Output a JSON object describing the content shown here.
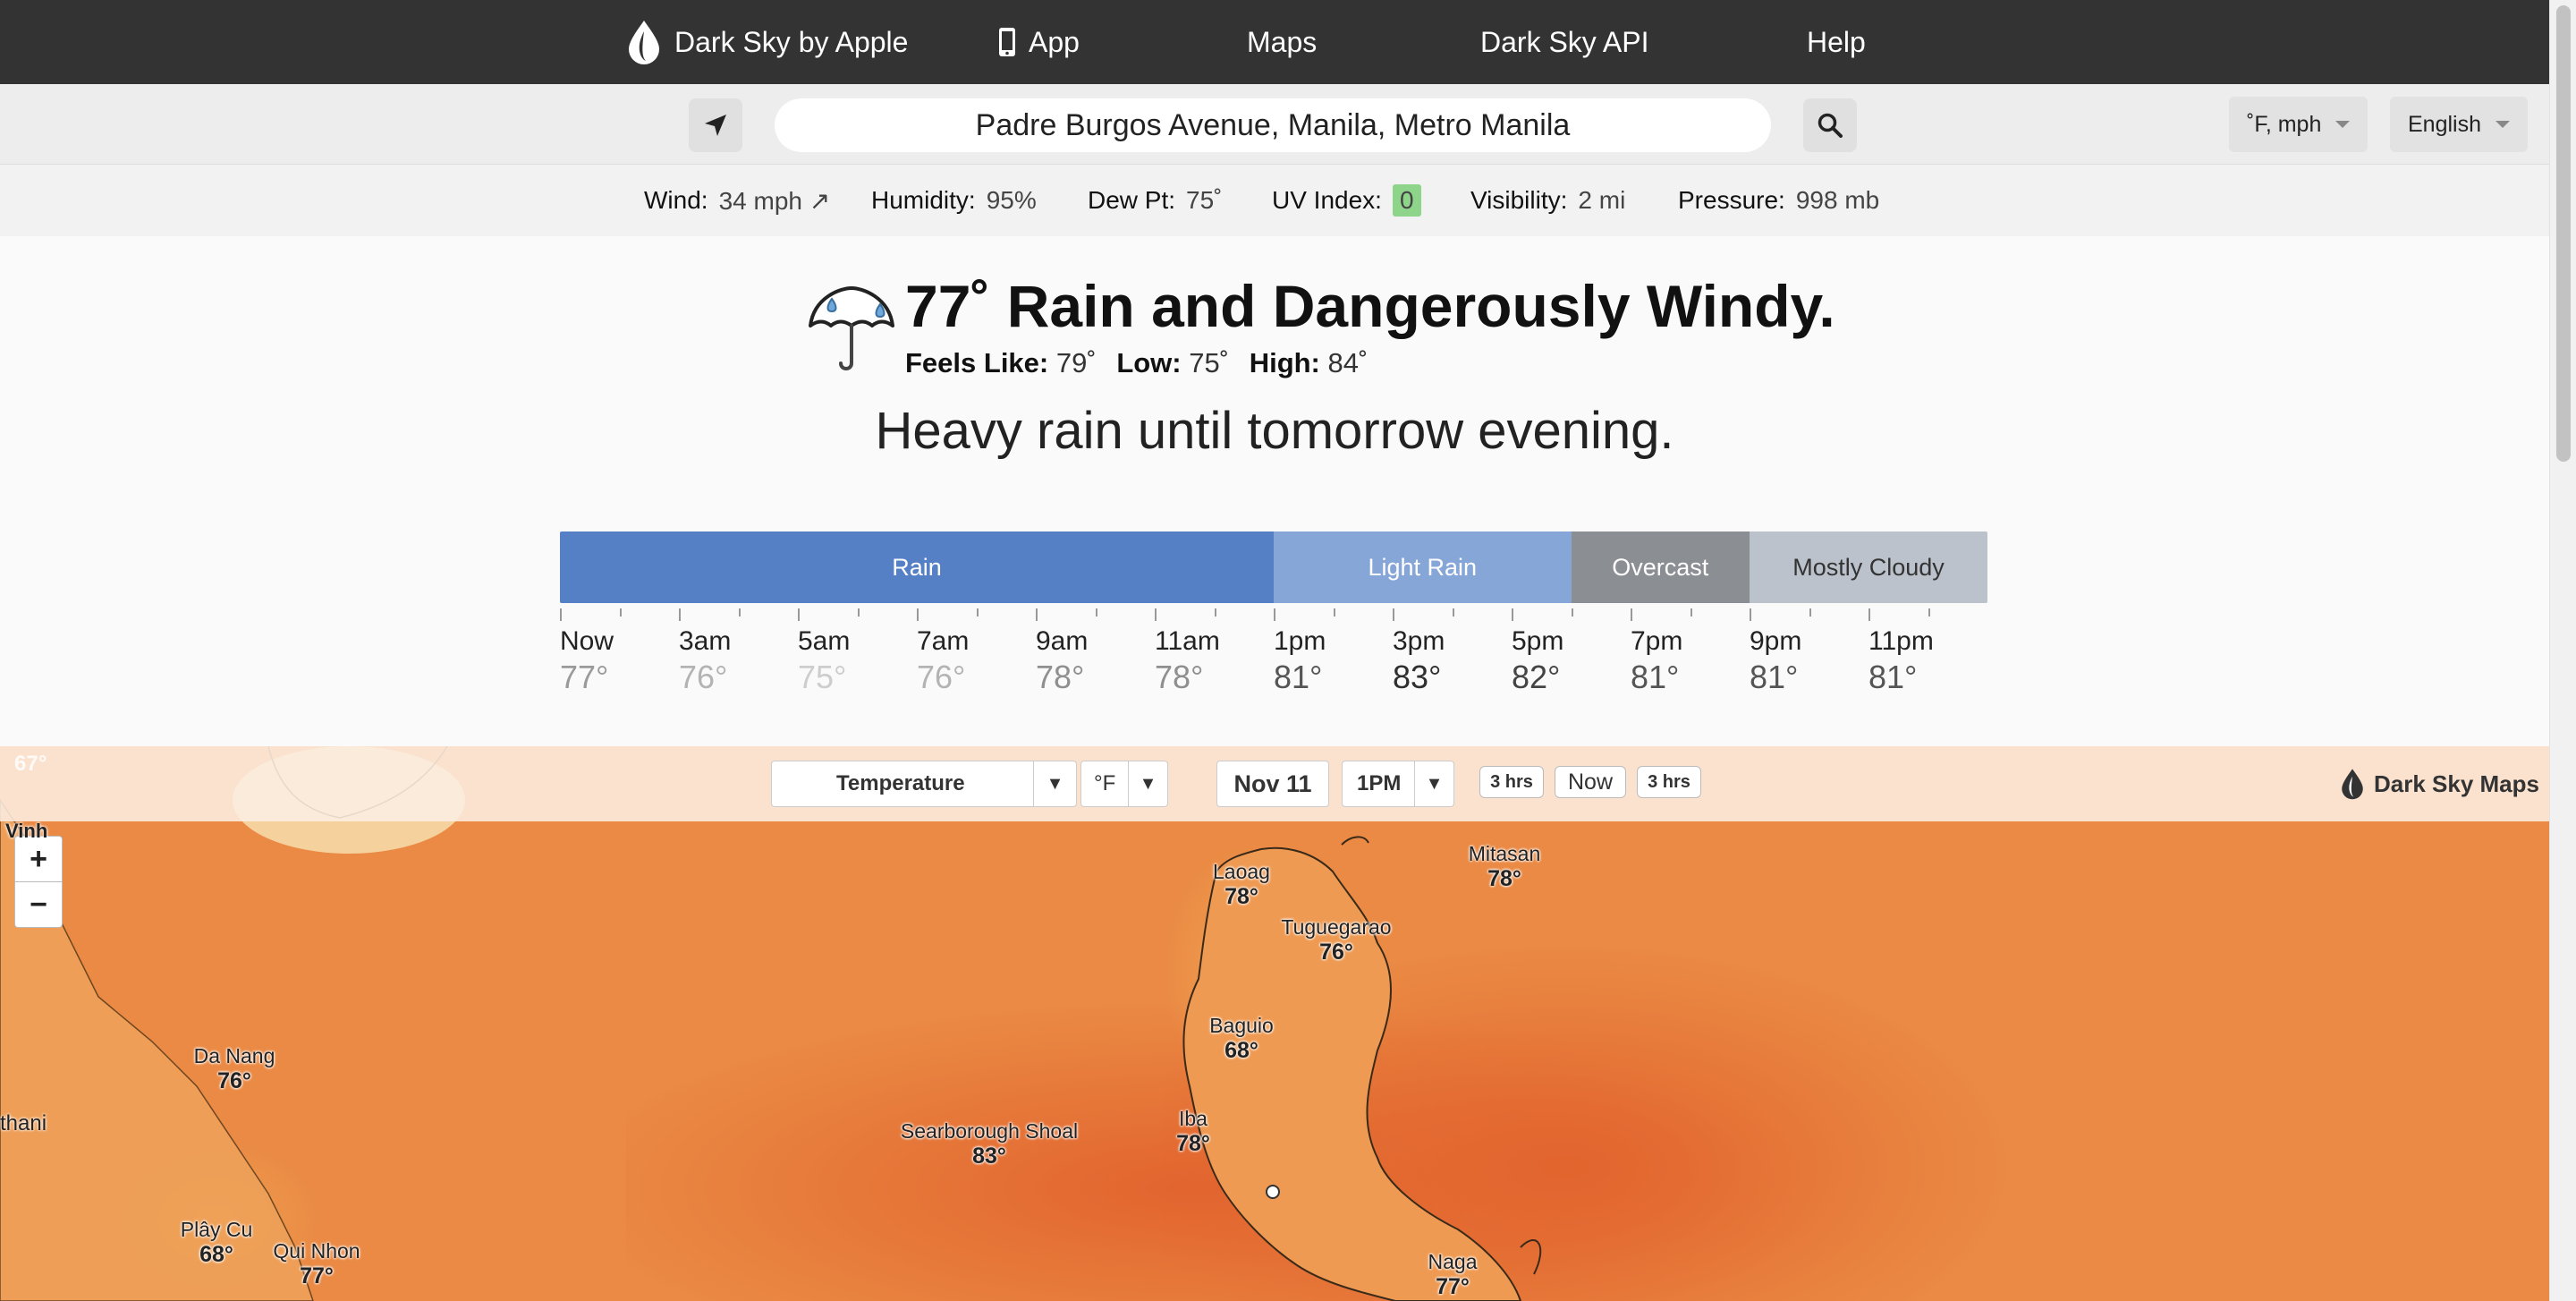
{
  "nav": {
    "brand": "Dark Sky by Apple",
    "app": "App",
    "maps": "Maps",
    "api": "Dark Sky API",
    "help": "Help"
  },
  "search": {
    "location": "Padre Burgos Avenue, Manila, Metro Manila",
    "units": "˚F, mph",
    "language": "English"
  },
  "conditions": {
    "wind_label": "Wind:",
    "wind_value": "34 mph ↗",
    "humidity_label": "Humidity:",
    "humidity_value": "95%",
    "dew_label": "Dew Pt:",
    "dew_value": "75˚",
    "uv_label": "UV Index:",
    "uv_value": "0",
    "visibility_label": "Visibility:",
    "visibility_value": "2 mi",
    "pressure_label": "Pressure:",
    "pressure_value": "998 mb"
  },
  "summary": {
    "title": "77˚ Rain and Dangerously Windy.",
    "feels_label": "Feels Like:",
    "feels_value": "79˚",
    "low_label": "Low:",
    "low_value": "75˚",
    "high_label": "High:",
    "high_value": "84˚",
    "text": "Heavy rain until tomorrow evening.",
    "icon": "umbrella-rain-icon"
  },
  "timeline": {
    "segments": [
      {
        "label": "Rain",
        "span_hours": 12,
        "color": "#5580c6",
        "text_color": "#ffffff"
      },
      {
        "label": "Light Rain",
        "span_hours": 5,
        "color": "#87a6d8",
        "text_color": "#ffffff"
      },
      {
        "label": "Overcast",
        "span_hours": 3,
        "color": "#8b8e93",
        "text_color": "#ffffff"
      },
      {
        "label": "Mostly Cloudy",
        "span_hours": 4,
        "color": "#bcc2cc",
        "text_color": "#333333"
      }
    ],
    "hours": [
      {
        "time": "Now",
        "temp": "77°",
        "color": "#9a9a9a"
      },
      {
        "time": "3am",
        "temp": "76°",
        "color": "#b3b3b3"
      },
      {
        "time": "5am",
        "temp": "75°",
        "color": "#cdcdcd"
      },
      {
        "time": "7am",
        "temp": "76°",
        "color": "#b3b3b3"
      },
      {
        "time": "9am",
        "temp": "78°",
        "color": "#8f8f8f"
      },
      {
        "time": "11am",
        "temp": "78°",
        "color": "#8f8f8f"
      },
      {
        "time": "1pm",
        "temp": "81°",
        "color": "#555555"
      },
      {
        "time": "3pm",
        "temp": "83°",
        "color": "#2f2f2f"
      },
      {
        "time": "5pm",
        "temp": "82°",
        "color": "#444444"
      },
      {
        "time": "7pm",
        "temp": "81°",
        "color": "#555555"
      },
      {
        "time": "9pm",
        "temp": "81°",
        "color": "#555555"
      },
      {
        "time": "11pm",
        "temp": "81°",
        "color": "#555555"
      }
    ]
  },
  "map": {
    "layer": "Temperature",
    "unit": "°F",
    "date": "Nov 11",
    "time": "1PM",
    "back": "3 hrs",
    "now": "Now",
    "forward": "3 hrs",
    "brand": "Dark Sky Maps",
    "corner_temp": "67°",
    "edge_label": "Vinh",
    "cities": [
      {
        "name": "Laoag",
        "temp": "78°"
      },
      {
        "name": "Mitasan",
        "temp": "78°"
      },
      {
        "name": "Tuguegarao",
        "temp": "76°"
      },
      {
        "name": "Baguio",
        "temp": "68°"
      },
      {
        "name": "Da Nang",
        "temp": "76°"
      },
      {
        "name": "Searborough Shoal",
        "temp": "83°"
      },
      {
        "name": "Iba",
        "temp": "78°"
      },
      {
        "name": "Plây Cu",
        "temp": "68°"
      },
      {
        "name": "Qui Nhon",
        "temp": "77°"
      },
      {
        "name": "Naga",
        "temp": "77°"
      }
    ],
    "partial_labels": [
      "thani"
    ]
  }
}
